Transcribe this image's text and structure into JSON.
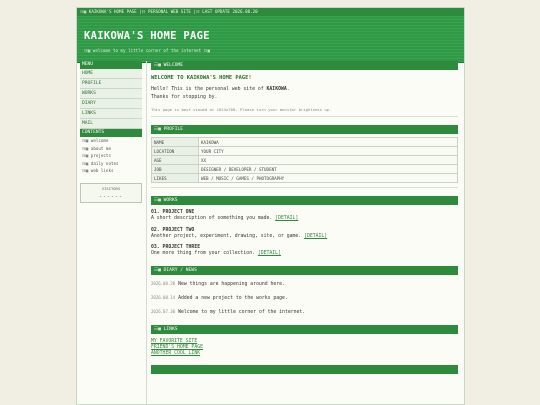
{
  "topbar": {
    "left": "☷▦ KAIKOWA'S HOME PAGE",
    "middle": "|☷ PERSONAL WEB SITE",
    "right": "|☷ LAST UPDATE 2026.08.20"
  },
  "header": {
    "title": "KAIKOWA'S HOME PAGE",
    "subtitle": "☷▦ welcome to my little corner of the internet ☷▦"
  },
  "sidebar": {
    "menu_heading": "MENU",
    "menu": [
      "HOME",
      "PROFILE",
      "WORKS",
      "DIARY",
      "LINKS",
      "MAIL"
    ],
    "contents_heading": "CONTENTS",
    "contents": [
      "☷▦ welcome",
      "☷▦ about me",
      "☷▦ projects",
      "☷▦ daily notes",
      "☷▦ web links"
    ],
    "visitors_label": "VISITORS",
    "visitors_count": "------"
  },
  "welcome": {
    "heading": "☷▦ WELCOME",
    "title": "WELCOME TO KAIKOWA'S HOME PAGE!",
    "line1_pre": "Hello! This is the personal web site of ",
    "line1_name": "KAIKOWA",
    "line1_post": ".",
    "line2": "Thanks for stopping by.",
    "note": "This page is best viewed at 1024x768. Please turn your monitor brightness up."
  },
  "profile": {
    "heading": "☷▦ PROFILE",
    "rows": [
      {
        "k": "NAME",
        "v": "KAIKOWA"
      },
      {
        "k": "LOCATION",
        "v": "YOUR CITY"
      },
      {
        "k": "AGE",
        "v": "XX"
      },
      {
        "k": "JOB",
        "v": "DESIGNER / DEVELOPER / STUDENT"
      },
      {
        "k": "LIKES",
        "v": "WEB / MUSIC / GAMES / PHOTOGRAPHY"
      }
    ]
  },
  "works": {
    "heading": "☷▦ WORKS",
    "items": [
      {
        "title": "01. PROJECT ONE",
        "desc": "A short description of something you made.",
        "link": "[DETAIL]"
      },
      {
        "title": "02. PROJECT TWO",
        "desc": "Another project, experiment, drawing, site, or game.",
        "link": "[DETAIL]"
      },
      {
        "title": "03. PROJECT THREE",
        "desc": "One more thing from your collection.",
        "link": "[DETAIL]"
      }
    ]
  },
  "diary": {
    "heading": "☷▦ DIARY / NEWS",
    "entries": [
      {
        "date": "2026.08.20",
        "text": "New things are happening around here."
      },
      {
        "date": "2026.08.14",
        "text": "Added a new project to the works page."
      },
      {
        "date": "2026.07.30",
        "text": "Welcome to my little corner of the internet."
      }
    ]
  },
  "links": {
    "heading": "☷▦ LINKS",
    "items": [
      "MY FAVORITE SITE",
      "FRIEND'S HOME PAGE",
      "ANOTHER COOL LINK"
    ]
  },
  "colors": {
    "accent": "#2e8b3d",
    "background": "#f1efe3"
  }
}
